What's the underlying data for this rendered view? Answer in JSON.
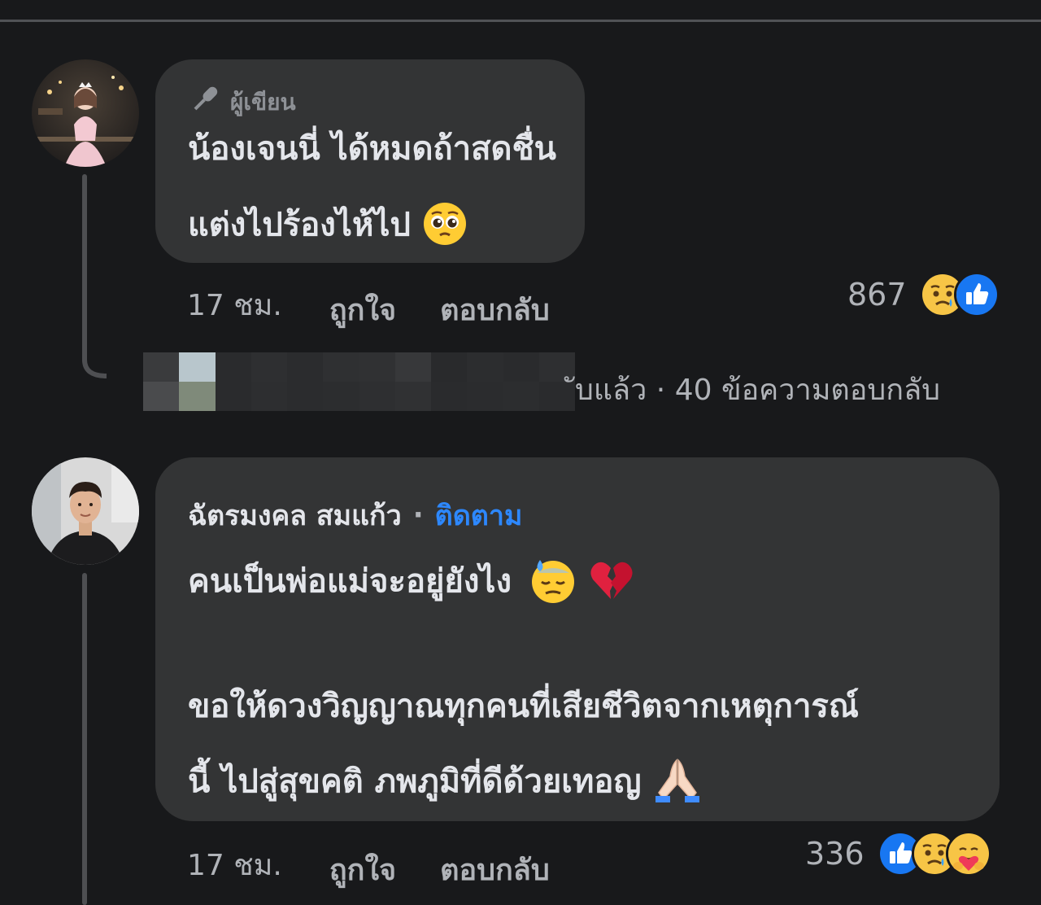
{
  "comments": [
    {
      "author_badge": "ผู้เขียน",
      "text_lines": [
        "น้องเจนนี่ ได้หมดถ้าสดชื่น",
        "แต่งไปร้องไห้ไป"
      ],
      "time": "17 ชม.",
      "like_label": "ถูกใจ",
      "reply_label": "ตอบกลับ",
      "reaction_count": "867",
      "reaction_icons": [
        "sad-face",
        "like-thumb"
      ]
    },
    {
      "author_name": "ฉัตรมงคล สมแก้ว",
      "separator": "·",
      "follow_label": "ติดตาม",
      "text_line_1": "คนเป็นพ่อแม่จะอยู่ยังไง",
      "text_lines_2": [
        "ขอให้ดวงวิญญาณทุกคนที่เสียชีวิตจากเหตุการณ์",
        "นี้ ไปสู่สุขคติ ภพภูมิที่ดีด้วยเทอญ"
      ],
      "time": "17 ชม.",
      "like_label": "ถูกใจ",
      "reply_label": "ตอบกลับ",
      "reaction_count": "336",
      "reaction_icons": [
        "like-thumb",
        "sad-face",
        "care-face"
      ]
    }
  ],
  "replies_summary": {
    "tail_text": "ับแล้ว",
    "separator": "·",
    "count_text": "40 ข้อความตอบกลับ"
  },
  "colors": {
    "background": "#18191b",
    "bubble": "#333435",
    "link_blue": "#2d88ff",
    "secondary_text": "#b0b3b8",
    "like_blue": "#1877f2"
  }
}
